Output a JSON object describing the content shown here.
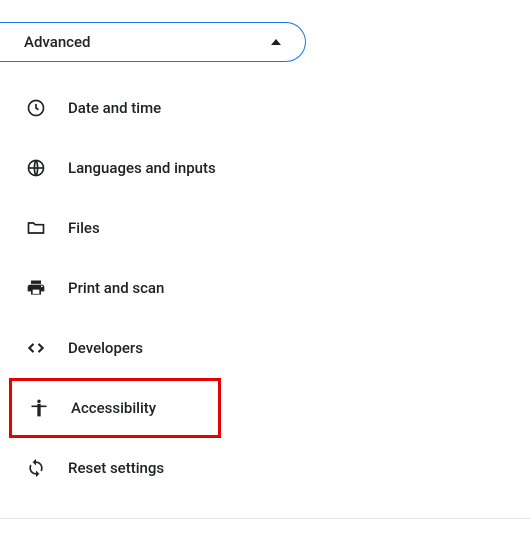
{
  "advanced": {
    "label": "Advanced"
  },
  "menu": {
    "items": [
      {
        "label": "Date and time"
      },
      {
        "label": "Languages and inputs"
      },
      {
        "label": "Files"
      },
      {
        "label": "Print and scan"
      },
      {
        "label": "Developers"
      },
      {
        "label": "Accessibility"
      },
      {
        "label": "Reset settings"
      }
    ]
  }
}
